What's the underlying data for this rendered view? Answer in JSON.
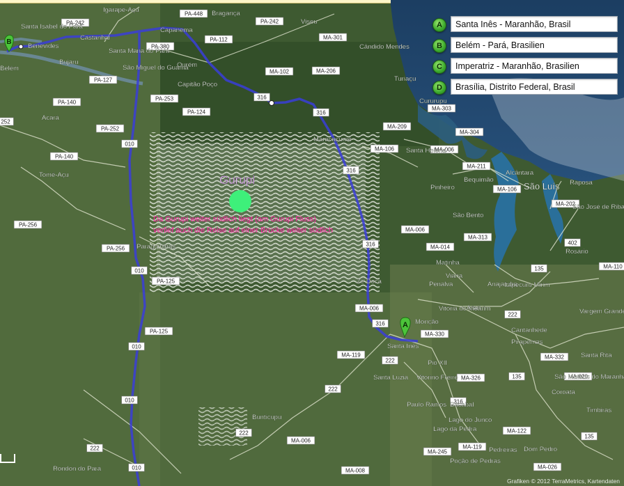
{
  "waypoints": [
    {
      "letter": "A",
      "text": "Santa Inês - Maranhão, Brasil"
    },
    {
      "letter": "B",
      "text": "Belém - Pará, Brasilien"
    },
    {
      "letter": "C",
      "text": "Imperatriz - Maranhão, Brasilien"
    },
    {
      "letter": "D",
      "text": "Brasília, Distrito Federal, Brasil"
    }
  ],
  "annotation": {
    "title": "Gurupi",
    "line1": "Da Gurupi weiter südlich liegt (am Gurupi Fluss)",
    "line2": "verlief auch die Reise auf einer Brücke weiter südlich",
    "title_color": "#e8c8f0",
    "text_color": "#ff1fa0",
    "dot_color": "#3ef07a"
  },
  "markers": {
    "a": "A",
    "b": "B"
  },
  "route_color": "#3a3dd8",
  "copyright": "Grafiken © 2012 TerraMetrics, Kartendaten",
  "cities": [
    "Igarapé-Açu",
    "Bragança",
    "Santa Isabel do Pará",
    "Castanhal",
    "Capanema",
    "Viseu",
    "Benevides",
    "Santa Maria do Pará",
    "Belém",
    "Bujaru",
    "São Miguel do Guamá",
    "Ourém",
    "Cândido Mendes",
    "Turiaçu",
    "Capitão Poço",
    "Cururupu",
    "Acará",
    "Maracaçumé",
    "Santa Helena",
    "Tomé-Açu",
    "Pinheiro",
    "Bequimão",
    "Alcântara",
    "São Luís",
    "Raposa",
    "São José de Ribamar",
    "São Bento",
    "Paragominas",
    "Matinha",
    "Rosário",
    "Zé Doca",
    "Penalva",
    "Viana",
    "Anajatuba",
    "Itapecuru Mirim",
    "Vitória do Mearim",
    "Arari",
    "Monção",
    "Vargem Grande",
    "Santa Inês",
    "Cantanhede",
    "Pirapemas",
    "Pio XII",
    "Santa Rita",
    "Santa Luzia",
    "Vitorino Freire",
    "São Mateus do Maranhão",
    "Coroatá",
    "Paulo Ramos",
    "Bacabal",
    "Timbiras",
    "Bunticupu",
    "Lago do Junco",
    "Lago da Pedra",
    "Pedreiras",
    "Dom Pedro",
    "Poção de Pedras",
    "Rondon do Pará"
  ],
  "roads": [
    "PA-242",
    "PA-448",
    "PA-242",
    "MA-301",
    "PA-380",
    "PA-112",
    "PA-127",
    "MA-102",
    "MA-206",
    "PA-253",
    "316",
    "316",
    "PA-140",
    "PA-124",
    "MA-303",
    "252",
    "PA-252",
    "MA-209",
    "MA-304",
    "010",
    "MA-106",
    "MA-006",
    "PA-140",
    "316",
    "MA-211",
    "MA-106",
    "MA-202",
    "MA-006",
    "MA-313",
    "PA-256",
    "PA-256",
    "316",
    "402",
    "MA-014",
    "010",
    "135",
    "MA-110",
    "PA-125",
    "MA-006",
    "316",
    "MA-330",
    "PA-125",
    "222",
    "MA-119",
    "222",
    "MA-332",
    "010",
    "MA-326",
    "135",
    "MA-020",
    "222",
    "010",
    "316",
    "MA-122",
    "222",
    "MA-006",
    "MA-119",
    "MA-245",
    "MA-026",
    "222",
    "MA-008",
    "135",
    "010"
  ]
}
